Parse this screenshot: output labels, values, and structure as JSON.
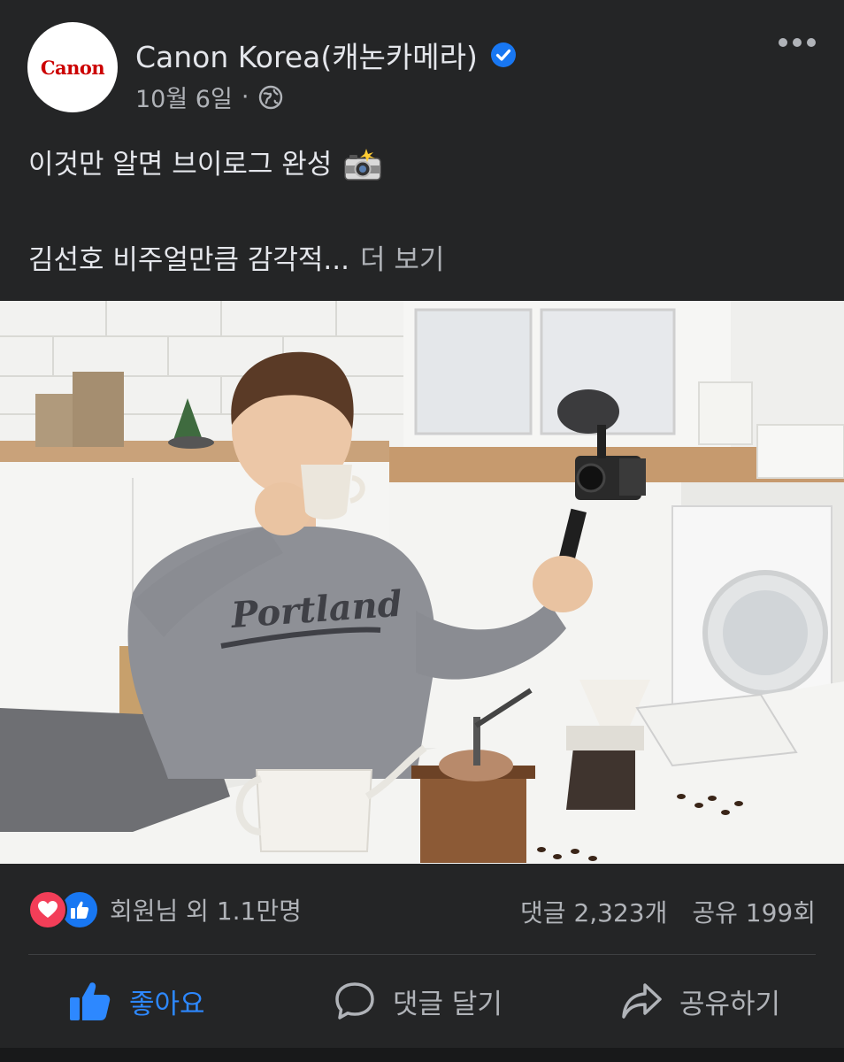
{
  "page": {
    "name": "Canon Korea(캐논카메라)",
    "logo_text": "Canon",
    "date": "10월 6일",
    "separator": "·",
    "privacy_icon": "globe-icon",
    "more_icon": "more-options-icon"
  },
  "post": {
    "line1": "이것만 알면 브이로그 완성",
    "line1_emoji": "camera-flash-emoji",
    "line2": "김선호 비주얼만큼 감각적...",
    "see_more": "더 보기",
    "photo": "man-in-gray-portland-sweatshirt-drinking-coffee-holding-vlog-camera-in-kitchen"
  },
  "reactions": {
    "icons": [
      "love-reaction-icon",
      "like-reaction-icon"
    ],
    "summary": "회원님 외 1.1만명",
    "comments": "댓글 2,323개",
    "shares": "공유 199회"
  },
  "actions": {
    "like": "좋아요",
    "comment": "댓글 달기",
    "share": "공유하기"
  },
  "colors": {
    "background": "#242526",
    "text_primary": "#e4e6eb",
    "text_secondary": "#b0b3b8",
    "like_blue": "#2d88ff",
    "verified_blue": "#1877f2",
    "love_red": "#f33e58",
    "canon_red": "#cc0000"
  }
}
